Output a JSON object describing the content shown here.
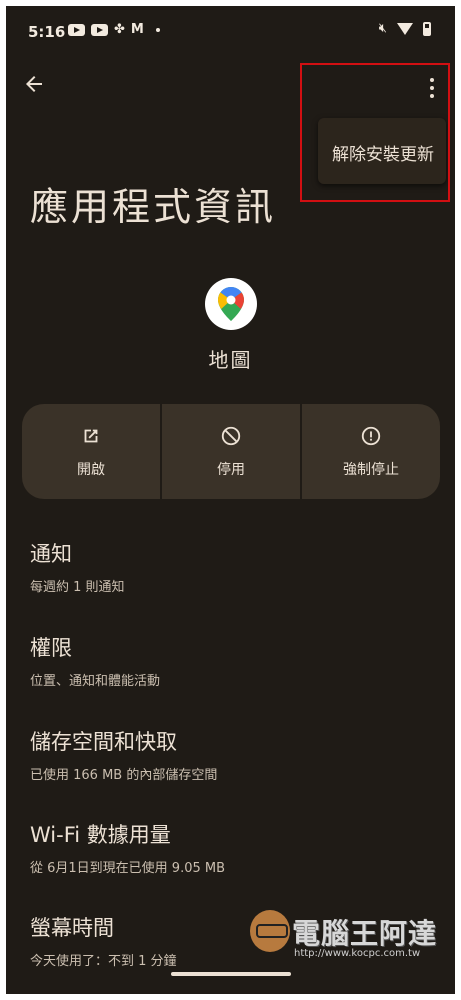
{
  "status_bar": {
    "time": "5:16",
    "gmail_glyph": "M",
    "icons": [
      "youtube-icon",
      "youtube-icon",
      "pinwheel-icon",
      "gmail-icon",
      "notification-dot",
      "mute-icon",
      "wifi-icon",
      "battery-icon"
    ]
  },
  "menu": {
    "uninstall_updates": "解除安裝更新"
  },
  "page": {
    "title": "應用程式資訊"
  },
  "app": {
    "name": "地圖",
    "icon": "google-maps-icon"
  },
  "actions": [
    {
      "label": "開啟",
      "icon": "open-external-icon"
    },
    {
      "label": "停用",
      "icon": "disable-icon"
    },
    {
      "label": "強制停止",
      "icon": "alert-circle-icon"
    }
  ],
  "settings": [
    {
      "title": "通知",
      "subtitle": "每週約 1 則通知"
    },
    {
      "title": "權限",
      "subtitle": "位置、通知和體能活動"
    },
    {
      "title": "儲存空間和快取",
      "subtitle": "已使用 166 MB 的內部儲存空間"
    },
    {
      "title": "Wi-Fi 數據用量",
      "subtitle": "從 6月1日到現在已使用 9.05 MB"
    },
    {
      "title": "螢幕時間",
      "subtitle": "今天使用了：不到 1 分鐘"
    }
  ],
  "watermark": {
    "text": "電腦王阿達",
    "url": "http://www.kocpc.com.tw"
  },
  "colors": {
    "background": "#1f1b16",
    "surface": "#3a3228",
    "text": "#ece1d4",
    "highlight_border": "#d20f12"
  }
}
